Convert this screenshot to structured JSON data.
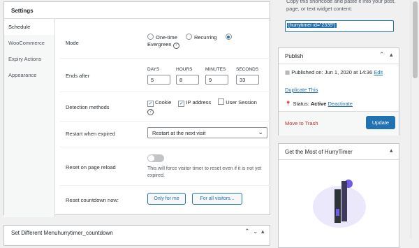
{
  "settings": {
    "title": "Settings",
    "tabs": [
      "Schedule",
      "WooCommerce",
      "Expiry Actions",
      "Appearance"
    ],
    "mode": {
      "label": "Mode",
      "options": [
        "One-time",
        "Recurring",
        "Evergreen"
      ],
      "selected": "Evergreen"
    },
    "ends_after": {
      "label": "Ends after",
      "units": [
        "DAYS",
        "HOURS",
        "MINUTES",
        "SECONDS"
      ],
      "values": [
        "5",
        "8",
        "9",
        "33"
      ]
    },
    "detection": {
      "label": "Detection methods",
      "options": [
        "Cookie",
        "IP address",
        "User Session"
      ],
      "checked": [
        true,
        true,
        false
      ]
    },
    "restart": {
      "label": "Restart when expired",
      "value": "Restart at the next visit"
    },
    "reset_reload": {
      "label": "Reset on page reload",
      "help": "This will force visitor timer to reset even if it is not yet expired."
    },
    "reset_countdown": {
      "label": "Reset countdown now:",
      "buttons": [
        "Only for me",
        "For all visitors..."
      ]
    }
  },
  "bottom_panel": {
    "title": "Set Different Menuhurrytimer_countdown"
  },
  "shortcode": {
    "text": "Copy this shortcode and paste it into your post, page, or text widget content:",
    "value": "[hurrytimer id=\"2339\"]"
  },
  "publish": {
    "title": "Publish",
    "published": "Published on: Jun 1, 2020 at 14:36",
    "edit": "Edit",
    "duplicate": "Duplicate This",
    "status_label": "Status:",
    "status_value": "Active",
    "deactivate": "Deactivate",
    "trash": "Move to Trash",
    "update": "Update"
  },
  "promo": {
    "title": "Get the Most of HurryTimer"
  },
  "colors": {
    "accent": "#2271b1",
    "trash": "#b32d2e",
    "toggle_off": "#c3c4c7"
  }
}
